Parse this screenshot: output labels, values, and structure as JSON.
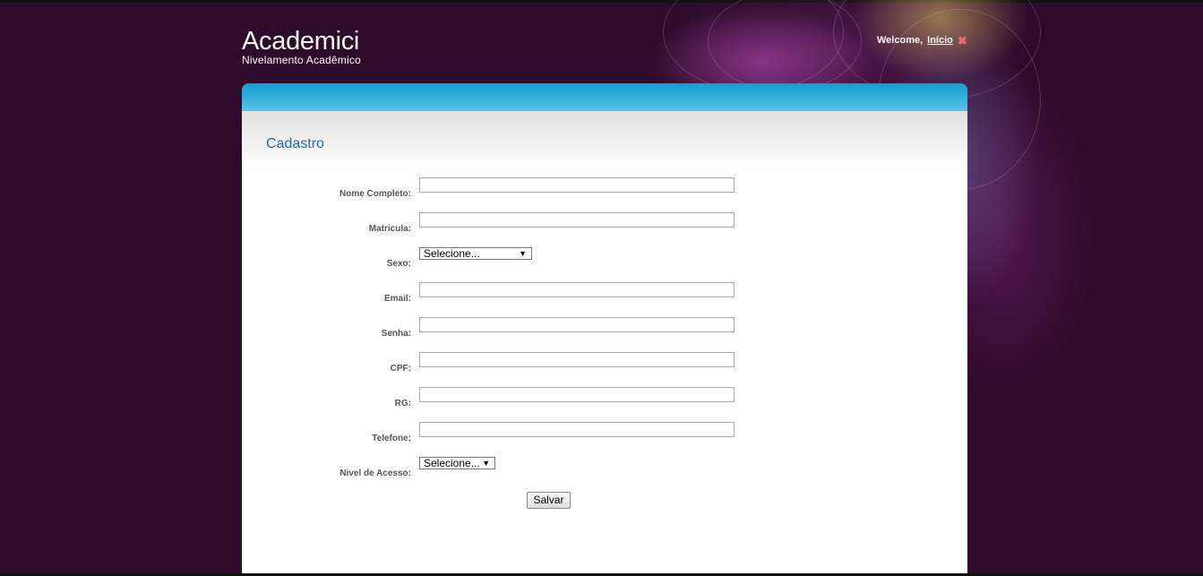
{
  "header": {
    "logo_title": "Academici",
    "logo_subtitle": "Nivelamento Acadêmico",
    "welcome_text": "Welcome,",
    "home_link": "Início",
    "close_icon": "close-icon"
  },
  "page": {
    "title": "Cadastro"
  },
  "form": {
    "nome_completo": {
      "label": "Nome Completo:",
      "value": ""
    },
    "matricula": {
      "label": "Matricula:",
      "value": ""
    },
    "sexo": {
      "label": "Sexo:",
      "selected": "Selecione..."
    },
    "email": {
      "label": "Email:",
      "value": ""
    },
    "senha": {
      "label": "Senha:",
      "value": ""
    },
    "cpf": {
      "label": "CPF:",
      "value": ""
    },
    "rg": {
      "label": "RG:",
      "value": ""
    },
    "telefone": {
      "label": "Telefone:",
      "value": ""
    },
    "nivel_acesso": {
      "label": "Nivel de Acesso:",
      "selected": "Selecione..."
    },
    "save_label": "Salvar"
  },
  "colors": {
    "background": "#2e0b2a",
    "header_bar": "#139dd3",
    "title": "#2a6a94"
  }
}
